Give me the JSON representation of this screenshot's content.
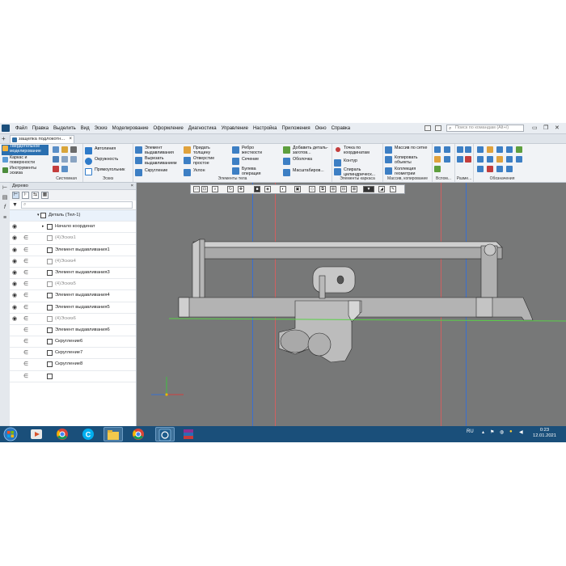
{
  "menubar": {
    "items": [
      "Файл",
      "Правка",
      "Выделить",
      "Вид",
      "Эскиз",
      "Моделирование",
      "Оформление",
      "Диагностика",
      "Управление",
      "Настройка",
      "Приложения",
      "Окно",
      "Справка"
    ],
    "search_placeholder": "Поиск по командам (Alt+/)"
  },
  "document_tab": {
    "title": "защелка подлокотн..."
  },
  "ribbon": {
    "left_modes": [
      {
        "label": "Твердотельное моделирование",
        "active": true
      },
      {
        "label": "Каркас и поверхности",
        "active": false
      },
      {
        "label": "Инструменты эскиза",
        "active": false
      }
    ],
    "groups": [
      {
        "label": "Системная"
      },
      {
        "label": "Эскиз",
        "commands": [
          "Автолиния",
          "Окружность",
          "Прямоугольник"
        ]
      },
      {
        "label": "Элементы тела",
        "commands": [
          "Элемент выдавливания",
          "Вырезать выдавливанием",
          "Скругление",
          "Придать толщину",
          "Отверстие простое",
          "Уклон",
          "Ребро жесткости",
          "Сечение",
          "Булева операция",
          "Добавить деталь-заготов...",
          "Оболочка",
          "Масштабиров..."
        ]
      },
      {
        "label": "Элементы каркаса",
        "commands": [
          "Точка по координатам",
          "Контур",
          "Спираль цилиндрическ..."
        ]
      },
      {
        "label": "Массив, копирование",
        "commands": [
          "Массив по сетке",
          "Копировать объекты",
          "Коллекция геометрии"
        ]
      },
      {
        "label": "Вспом..."
      },
      {
        "label": "Разме..."
      },
      {
        "label": "Обозначения"
      }
    ]
  },
  "tree": {
    "title": "Дерево",
    "search_placeholder": "",
    "rows": [
      {
        "label": "Деталь (Тел-1)",
        "dim": false,
        "eye": false,
        "rel": false,
        "indent": 48
      },
      {
        "label": "Начало координат",
        "dim": false,
        "eye": true,
        "rel": false,
        "indent": 56
      },
      {
        "label": "(4)Эскиз1",
        "dim": true,
        "eye": true,
        "rel": true,
        "indent": 56
      },
      {
        "label": "Элемент выдавливания1",
        "dim": false,
        "eye": true,
        "rel": true,
        "indent": 56
      },
      {
        "label": "(4)Эскиз4",
        "dim": true,
        "eye": true,
        "rel": true,
        "indent": 56
      },
      {
        "label": "Элемент выдавливания3",
        "dim": false,
        "eye": true,
        "rel": true,
        "indent": 56
      },
      {
        "label": "(4)Эскиз5",
        "dim": true,
        "eye": true,
        "rel": true,
        "indent": 56
      },
      {
        "label": "Элемент выдавливания4",
        "dim": false,
        "eye": true,
        "rel": true,
        "indent": 56
      },
      {
        "label": "Элемент выдавливания5",
        "dim": false,
        "eye": true,
        "rel": true,
        "indent": 56
      },
      {
        "label": "(4)Эскиз6",
        "dim": true,
        "eye": true,
        "rel": true,
        "indent": 56
      },
      {
        "label": "Элемент выдавливания6",
        "dim": false,
        "eye": false,
        "rel": true,
        "indent": 56
      },
      {
        "label": "Скругление6",
        "dim": false,
        "eye": false,
        "rel": true,
        "indent": 56
      },
      {
        "label": "Скругление7",
        "dim": false,
        "eye": false,
        "rel": true,
        "indent": 56
      },
      {
        "label": "Скругление8",
        "dim": false,
        "eye": false,
        "rel": true,
        "indent": 56
      },
      {
        "label": "",
        "dim": false,
        "eye": false,
        "rel": true,
        "indent": 56
      }
    ]
  },
  "taskbar": {
    "language": "RU",
    "time": "0:23",
    "date": "12.01.2021"
  },
  "colors": {
    "viewport_bg": "#777878",
    "model_face": "#b9b9b9",
    "model_edge": "#2b2b2b",
    "ground_line": "#5ad048",
    "guide_blue": "#3a6fd0",
    "guide_red": "#d06060",
    "taskbar": "#1a4f7a",
    "accent": "#2a6fb0"
  }
}
